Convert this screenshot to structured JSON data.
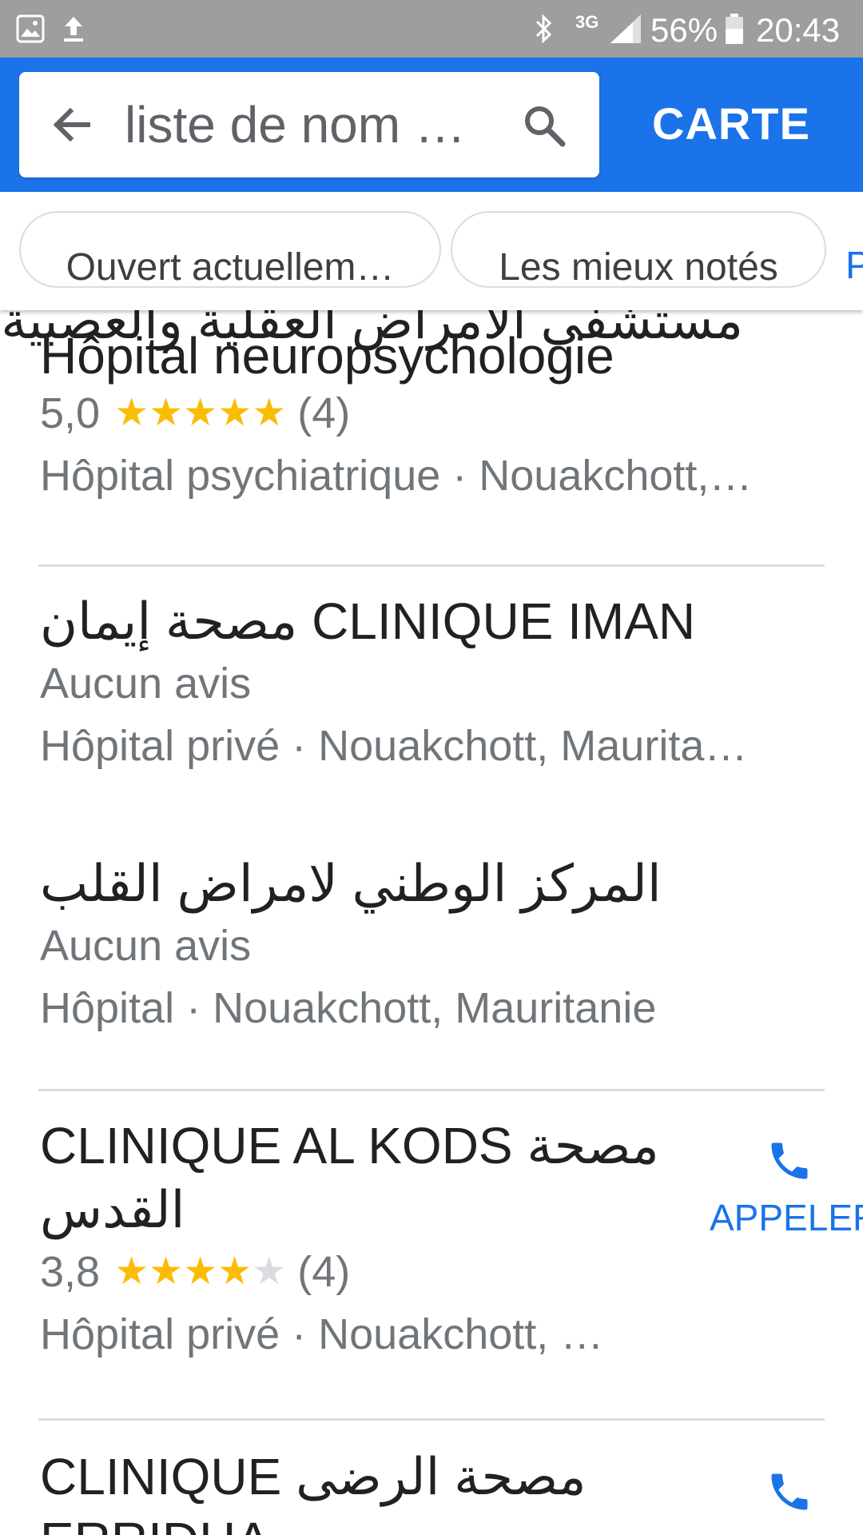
{
  "status_bar": {
    "network": "3G",
    "battery": "56%",
    "time": "20:43",
    "icons": [
      "image-icon",
      "upload-icon",
      "bluetooth-icon",
      "signal-icon",
      "battery-icon"
    ]
  },
  "search": {
    "query": "liste de nom …",
    "map_button": "CARTE"
  },
  "filters": {
    "chips": [
      "Ouvert actuellem…",
      "Les mieux notés"
    ],
    "more_partial": "P"
  },
  "results": [
    {
      "title_partial_arabic": "مستشفى الأمراض العقلية والعصبية",
      "title": "Hôpital neuropsychologie",
      "rating": "5,0",
      "stars": 5,
      "reviews": "(4)",
      "details": "Hôpital psychiatrique · Nouakchott,…"
    },
    {
      "title": "مصحة إيمان CLINIQUE IMAN",
      "reviews_text": "Aucun avis",
      "details": "Hôpital privé · Nouakchott, Maurita…"
    },
    {
      "title": "المركز الوطني لامراض القلب",
      "reviews_text": "Aucun avis",
      "details": "Hôpital · Nouakchott, Mauritanie"
    },
    {
      "title_line1": "CLINIQUE AL KODS مصحة",
      "title_line2": "القدس",
      "rating": "3,8",
      "stars": 3.8,
      "reviews": "(4)",
      "details": "Hôpital privé · Nouakchott, …",
      "action": "APPELER"
    },
    {
      "title_line1": "CLINIQUE مصحة الرضى",
      "title_line2": "ERRIDHA"
    }
  ],
  "colors": {
    "brand_blue": "#1a73e8",
    "status_bar": "#9e9e9e",
    "star": "#fbbc04",
    "divider": "#dadce0"
  }
}
